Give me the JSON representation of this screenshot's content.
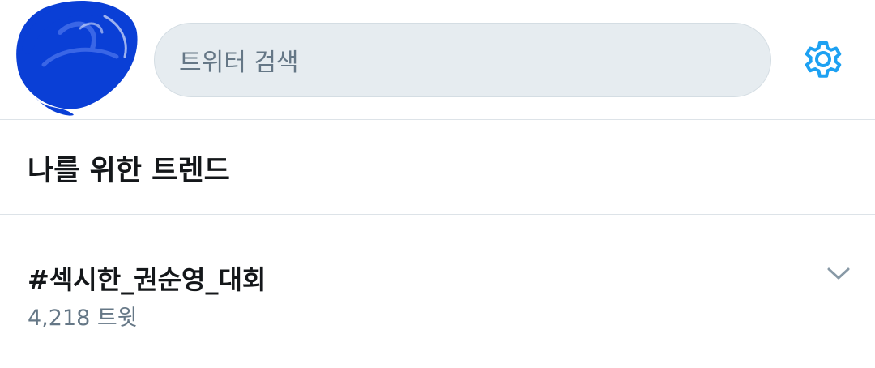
{
  "header": {
    "avatar_icon": "redacted-avatar",
    "search_placeholder": "트위터 검색",
    "settings_icon": "gear-icon",
    "accent_color": "#1da1f2"
  },
  "section": {
    "title": "나를 위한 트렌드"
  },
  "trends": [
    {
      "name": "#섹시한_권순영_대회",
      "count": "4,218 트윗",
      "menu_icon": "chevron-down-icon"
    }
  ]
}
